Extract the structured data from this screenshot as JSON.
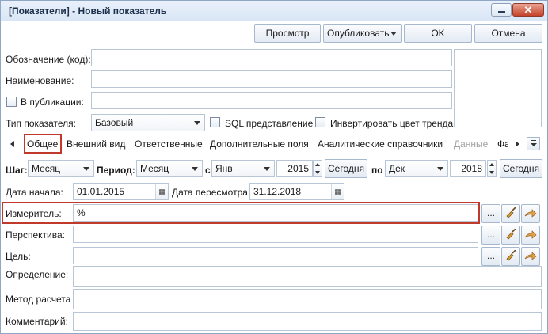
{
  "window": {
    "title": "[Показатели] - Новый показатель"
  },
  "toolbar": {
    "preview": "Просмотр",
    "publish": "Опубликовать",
    "ok": "OK",
    "cancel": "Отмена"
  },
  "form": {
    "code_label": "Обозначение (код):",
    "code_value": "",
    "name_label": "Наименование:",
    "name_value": "",
    "in_pub_label": "В публикации:",
    "in_pub_value": "",
    "type_label": "Тип показателя:",
    "type_value": "Базовый",
    "sql_label": "SQL представление",
    "invert_label": "Инвертировать цвет тренда"
  },
  "tabs": [
    {
      "label": "Общее",
      "active": true
    },
    {
      "label": "Внешний вид"
    },
    {
      "label": "Ответственные"
    },
    {
      "label": "Дополнительные поля"
    },
    {
      "label": "Аналитические справочники"
    },
    {
      "label": "Данные",
      "disabled": true
    },
    {
      "label": "Фа"
    }
  ],
  "period": {
    "step_label": "Шаг:",
    "step_value": "Месяц",
    "period_label": "Период:",
    "period_value": "Месяц",
    "from_label": "с",
    "from_month": "Янв",
    "from_year": "2015",
    "today1": "Сегодня",
    "to_label": "по",
    "to_month": "Дек",
    "to_year": "2018",
    "today2": "Сегодня"
  },
  "dates": {
    "start_label": "Дата начала:",
    "start_value": "01.01.2015",
    "review_label": "Дата пересмотра:",
    "review_value": "31.12.2018"
  },
  "fields": {
    "measure_label": "Измеритель:",
    "measure_value": "%",
    "perspective_label": "Перспектива:",
    "perspective_value": "",
    "goal_label": "Цель:",
    "goal_value": "",
    "definition_label": "Определение:",
    "definition_value": "",
    "method_label": "Метод расчета",
    "method_value": "",
    "comment_label": "Комментарий:",
    "comment_value": "",
    "ellipsis": "..."
  },
  "icons": {
    "broom": "broom-icon",
    "arrow": "arrow-icon",
    "calendar": "calendar-icon"
  },
  "colors": {
    "highlight": "#c0392b"
  }
}
